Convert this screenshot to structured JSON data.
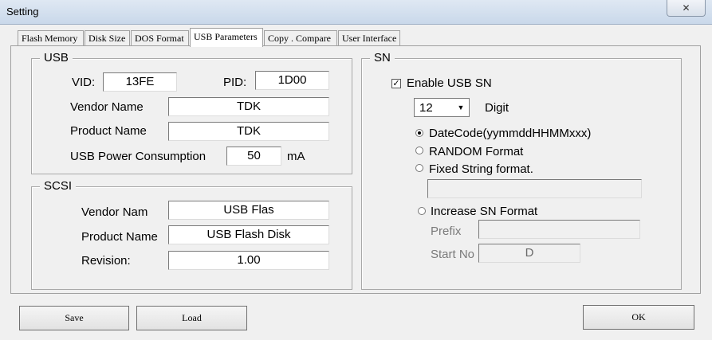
{
  "window": {
    "title": "Setting",
    "close_icon": "close-icon"
  },
  "tabs": [
    {
      "label": "Flash Memory",
      "active": false
    },
    {
      "label": "Disk Size",
      "active": false
    },
    {
      "label": "DOS Format",
      "active": false
    },
    {
      "label": "USB Parameters",
      "active": true
    },
    {
      "label": "Copy . Compare",
      "active": false
    },
    {
      "label": "User Interface",
      "active": false
    }
  ],
  "usb": {
    "group_label": "USB",
    "vid_label": "VID:",
    "vid_value": "13FE",
    "pid_label": "PID:",
    "pid_value": "1D00",
    "vendor_label": "Vendor Name",
    "vendor_value": "TDK",
    "product_label": "Product Name",
    "product_value": "TDK",
    "power_label": "USB Power Consumption",
    "power_value": "50",
    "power_unit": "mA"
  },
  "scsi": {
    "group_label": "SCSI",
    "vendor_label": "Vendor Nam",
    "vendor_value": "USB Flas",
    "product_label": "Product Name",
    "product_value": "USB Flash Disk",
    "revision_label": "Revision:",
    "revision_value": "1.00"
  },
  "sn": {
    "group_label": "SN",
    "enable_label": "Enable USB SN",
    "enable_checked": true,
    "digit_value": "12",
    "digit_label": "Digit",
    "radio_datecode": "DateCode(yymmddHHMMxxx)",
    "radio_random": "RANDOM Format",
    "radio_fixed": "Fixed String format.",
    "fixed_value": "",
    "radio_increase": "Increase SN Format",
    "prefix_label": "Prefix",
    "prefix_value": "",
    "start_label": "Start No",
    "start_value": "D"
  },
  "buttons": {
    "save": "Save",
    "load": "Load",
    "ok": "OK"
  }
}
